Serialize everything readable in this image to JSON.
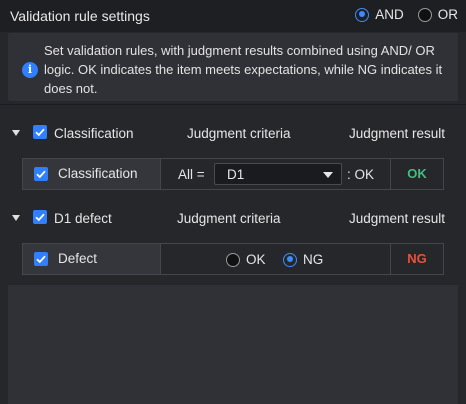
{
  "header": {
    "title": "Validation rule settings",
    "logic_options": [
      {
        "label": "AND",
        "selected": true
      },
      {
        "label": "OR",
        "selected": false
      }
    ]
  },
  "info": {
    "icon": "info-icon",
    "text": "Set validation rules, with judgment results combined using AND/ OR logic. OK indicates the item meets expectations, while NG indicates it does not."
  },
  "sections": [
    {
      "name": "Classification",
      "checked": true,
      "criteria_header": "Judgment criteria",
      "result_header": "Judgment result",
      "rule": {
        "name": "Classification",
        "checked": true,
        "prefix": "All =",
        "select_value": "D1",
        "suffix": ": OK",
        "result": "OK",
        "result_color": "#3fbf7f"
      }
    },
    {
      "name": "D1 defect",
      "checked": true,
      "criteria_header": "Judgment criteria",
      "result_header": "Judgment result",
      "rule": {
        "name": "Defect",
        "checked": true,
        "options": [
          {
            "label": "OK",
            "selected": false
          },
          {
            "label": "NG",
            "selected": true
          }
        ],
        "result": "NG",
        "result_color": "#e5533d"
      }
    }
  ],
  "colors": {
    "accent": "#2f7fff",
    "ok": "#3fbf7f",
    "ng": "#e5533d"
  }
}
